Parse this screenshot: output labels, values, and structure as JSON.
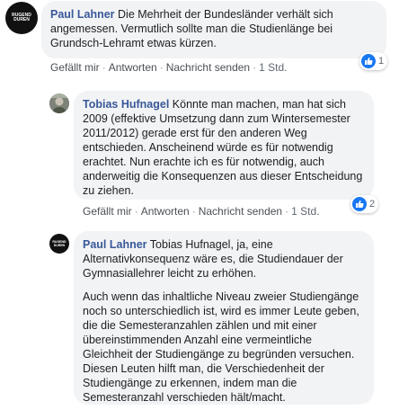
{
  "comments": [
    {
      "avatar_text": "RUGEND\nDUREN",
      "author": "Paul Lahner",
      "text": "Die Mehrheit der Bundesländer verhält sich angemessen. Vermutlich sollte man die Studienlänge bei Grundsch-Lehramt etwas kürzen.",
      "actions": {
        "like": "Gefällt mir",
        "reply": "Antworten",
        "send": "Nachricht senden",
        "time": "1 Std."
      },
      "reaction_count": "1"
    },
    {
      "author": "Tobias Hufnagel",
      "text": "Könnte man machen, man hat sich 2009 (effektive Umsetzung dann zum Wintersemester 2011/2012) gerade erst für den anderen Weg entschieden. Anscheinend würde es für notwendig erachtet. Nun erachte ich es für notwendig, auch anderweitig die Konsequenzen aus dieser Entscheidung zu ziehen.",
      "actions": {
        "like": "Gefällt mir",
        "reply": "Antworten",
        "send": "Nachricht senden",
        "time": "1 Std."
      },
      "reaction_count": "2"
    },
    {
      "avatar_text": "RUGEND\nDUREN",
      "author": "Paul Lahner",
      "text": "Tobias Hufnagel, ja, eine Alternativkonsequenz wäre es, die Studiendauer der Gymnasiallehrer leicht zu erhöhen.",
      "text2": "Auch wenn das inhaltliche Niveau zweier Studiengänge noch so unterschiedlich ist, wird es immer Leute geben, die die Semesteranzahlen zählen und mit einer übereinstimmenden Anzahl eine vermeintliche Gleichheit der Studiengänge zu begründen versuchen. Diesen Leuten hilft man, die Verschiedenheit der Studiengänge zu erkennen, indem man die Semesteranzahl verschieden hält/macht."
    }
  ],
  "colors": {
    "author": "#385898",
    "bubble": "#f2f3f5",
    "like": "#1877f2"
  }
}
